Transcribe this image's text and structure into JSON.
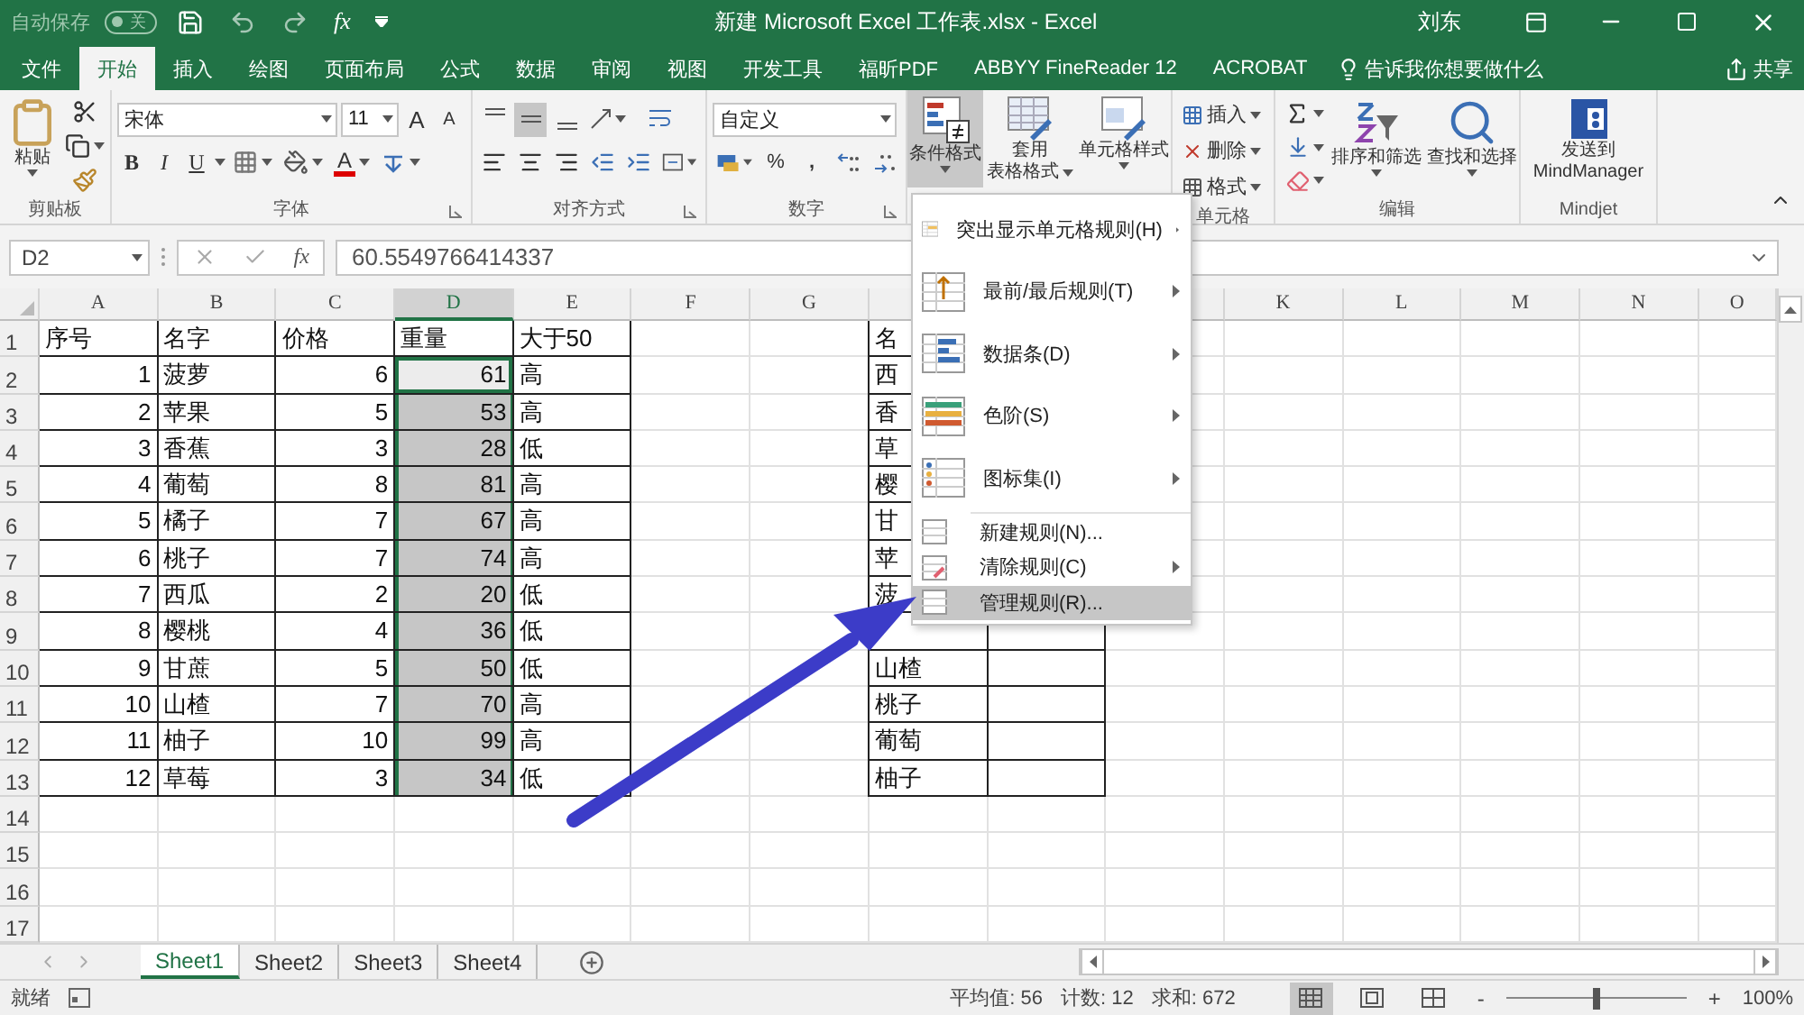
{
  "title_bar": {
    "autosave_label": "自动保存",
    "autosave": {
      "on": false,
      "label": "关"
    },
    "qat_function": "fx",
    "title": "新建 Microsoft Excel 工作表.xlsx  -  Excel",
    "user": "刘东"
  },
  "tabs": [
    {
      "label": "文件",
      "selected": false
    },
    {
      "label": "开始",
      "selected": true
    },
    {
      "label": "插入",
      "selected": false
    },
    {
      "label": "绘图",
      "selected": false
    },
    {
      "label": "页面布局",
      "selected": false
    },
    {
      "label": "公式",
      "selected": false
    },
    {
      "label": "数据",
      "selected": false
    },
    {
      "label": "审阅",
      "selected": false
    },
    {
      "label": "视图",
      "selected": false
    },
    {
      "label": "开发工具",
      "selected": false
    },
    {
      "label": "福昕PDF",
      "selected": false
    },
    {
      "label": "ABBYY FineReader 12",
      "selected": false
    },
    {
      "label": "ACROBAT",
      "selected": false
    }
  ],
  "tell_me": "告诉我你想要做什么",
  "share": "共享",
  "ribbon": {
    "clipboard": {
      "paste": "粘贴",
      "label": "剪贴板"
    },
    "font": {
      "name": "宋体",
      "size": "11",
      "grow": "A",
      "shrink": "A",
      "bold": "B",
      "italic": "I",
      "underline": "U",
      "color_letter": "A",
      "label": "字体"
    },
    "alignment": {
      "vertical": [
        {
          "selected": false
        },
        {
          "selected": true
        },
        {
          "selected": false
        }
      ],
      "label": "对齐方式"
    },
    "number": {
      "format": "自定义",
      "percent": "%",
      "comma": ",",
      "label": "数字"
    },
    "styles": {
      "conditional": {
        "label": "条件格式",
        "pressed": true
      },
      "table_format": [
        "套用",
        "表格格式"
      ],
      "cell_styles": "单元格样式"
    },
    "cells": {
      "insert": "插入",
      "delete": "删除",
      "format": "格式",
      "label": "单元格"
    },
    "editing": {
      "sort": "排序和筛选",
      "find": "查找和选择",
      "label": "编辑"
    },
    "mindjet": {
      "send": [
        "发送到",
        "MindManager"
      ],
      "label": "Mindjet"
    }
  },
  "formula_bar": {
    "name_box": "D2",
    "function_label": "fx",
    "formula": "60.5549766414337"
  },
  "columns": [
    {
      "label": "A",
      "selected": false
    },
    {
      "label": "B",
      "selected": false
    },
    {
      "label": "C",
      "selected": false
    },
    {
      "label": "D",
      "selected": true
    },
    {
      "label": "E",
      "selected": false
    },
    {
      "label": "F",
      "selected": false
    },
    {
      "label": "G",
      "selected": false
    },
    {},
    {},
    {},
    {
      "label": "K",
      "selected": false
    },
    {
      "label": "L",
      "selected": false
    },
    {
      "label": "M",
      "selected": false
    },
    {
      "label": "N",
      "selected": false
    },
    {
      "label": "O",
      "selected": false
    }
  ],
  "rows": [
    {
      "label": "1",
      "cells": [
        {
          "text": "序号",
          "kind": "text",
          "selected": false
        },
        {
          "text": "名字",
          "kind": "text",
          "selected": false
        },
        {
          "text": "价格",
          "kind": "text",
          "selected": false
        },
        {
          "text": "重量",
          "kind": "text",
          "selected": false
        },
        {
          "text": "大于50",
          "kind": "text",
          "selected": false
        }
      ],
      "lookup": {
        "text": "名"
      }
    },
    {
      "label": "2",
      "cells": [
        {
          "text": "1",
          "kind": "number",
          "selected": false
        },
        {
          "text": "菠萝",
          "kind": "text",
          "selected": false
        },
        {
          "text": "6",
          "kind": "number",
          "selected": false
        },
        {
          "text": "61",
          "kind": "number",
          "selected": true,
          "active": true
        },
        {
          "text": "高",
          "kind": "text",
          "selected": false
        }
      ],
      "lookup": {
        "text": "西"
      }
    },
    {
      "label": "3",
      "cells": [
        {
          "text": "2",
          "kind": "number",
          "selected": false
        },
        {
          "text": "苹果",
          "kind": "text",
          "selected": false
        },
        {
          "text": "5",
          "kind": "number",
          "selected": false
        },
        {
          "text": "53",
          "kind": "number",
          "selected": true
        },
        {
          "text": "高",
          "kind": "text",
          "selected": false
        }
      ],
      "lookup": {
        "text": "香"
      }
    },
    {
      "label": "4",
      "cells": [
        {
          "text": "3",
          "kind": "number",
          "selected": false
        },
        {
          "text": "香蕉",
          "kind": "text",
          "selected": false
        },
        {
          "text": "3",
          "kind": "number",
          "selected": false
        },
        {
          "text": "28",
          "kind": "number",
          "selected": true
        },
        {
          "text": "低",
          "kind": "text",
          "selected": false
        }
      ],
      "lookup": {
        "text": "草"
      }
    },
    {
      "label": "5",
      "cells": [
        {
          "text": "4",
          "kind": "number",
          "selected": false
        },
        {
          "text": "葡萄",
          "kind": "text",
          "selected": false
        },
        {
          "text": "8",
          "kind": "number",
          "selected": false
        },
        {
          "text": "81",
          "kind": "number",
          "selected": true
        },
        {
          "text": "高",
          "kind": "text",
          "selected": false
        }
      ],
      "lookup": {
        "text": "樱"
      }
    },
    {
      "label": "6",
      "cells": [
        {
          "text": "5",
          "kind": "number",
          "selected": false
        },
        {
          "text": "橘子",
          "kind": "text",
          "selected": false
        },
        {
          "text": "7",
          "kind": "number",
          "selected": false
        },
        {
          "text": "67",
          "kind": "number",
          "selected": true
        },
        {
          "text": "高",
          "kind": "text",
          "selected": false
        }
      ],
      "lookup": {
        "text": "甘"
      }
    },
    {
      "label": "7",
      "cells": [
        {
          "text": "6",
          "kind": "number",
          "selected": false
        },
        {
          "text": "桃子",
          "kind": "text",
          "selected": false
        },
        {
          "text": "7",
          "kind": "number",
          "selected": false
        },
        {
          "text": "74",
          "kind": "number",
          "selected": true
        },
        {
          "text": "高",
          "kind": "text",
          "selected": false
        }
      ],
      "lookup": {
        "text": "苹"
      }
    },
    {
      "label": "8",
      "cells": [
        {
          "text": "7",
          "kind": "number",
          "selected": false
        },
        {
          "text": "西瓜",
          "kind": "text",
          "selected": false
        },
        {
          "text": "2",
          "kind": "number",
          "selected": false
        },
        {
          "text": "20",
          "kind": "number",
          "selected": true
        },
        {
          "text": "低",
          "kind": "text",
          "selected": false
        }
      ],
      "lookup": {
        "text": "菠"
      }
    },
    {
      "label": "9",
      "cells": [
        {
          "text": "8",
          "kind": "number",
          "selected": false
        },
        {
          "text": "樱桃",
          "kind": "text",
          "selected": false
        },
        {
          "text": "4",
          "kind": "number",
          "selected": false
        },
        {
          "text": "36",
          "kind": "number",
          "selected": true
        },
        {
          "text": "低",
          "kind": "text",
          "selected": false
        }
      ],
      "lookup": {}
    },
    {
      "label": "10",
      "cells": [
        {
          "text": "9",
          "kind": "number",
          "selected": false
        },
        {
          "text": "甘蔗",
          "kind": "text",
          "selected": false
        },
        {
          "text": "5",
          "kind": "number",
          "selected": false
        },
        {
          "text": "50",
          "kind": "number",
          "selected": true
        },
        {
          "text": "低",
          "kind": "text",
          "selected": false
        }
      ],
      "lookup": {
        "text": "山楂"
      }
    },
    {
      "label": "11",
      "cells": [
        {
          "text": "10",
          "kind": "number",
          "selected": false
        },
        {
          "text": "山楂",
          "kind": "text",
          "selected": false
        },
        {
          "text": "7",
          "kind": "number",
          "selected": false
        },
        {
          "text": "70",
          "kind": "number",
          "selected": true
        },
        {
          "text": "高",
          "kind": "text",
          "selected": false
        }
      ],
      "lookup": {
        "text": "桃子"
      }
    },
    {
      "label": "12",
      "cells": [
        {
          "text": "11",
          "kind": "number",
          "selected": false
        },
        {
          "text": "柚子",
          "kind": "text",
          "selected": false
        },
        {
          "text": "10",
          "kind": "number",
          "selected": false
        },
        {
          "text": "99",
          "kind": "number",
          "selected": true
        },
        {
          "text": "高",
          "kind": "text",
          "selected": false
        }
      ],
      "lookup": {
        "text": "葡萄"
      }
    },
    {
      "label": "13",
      "cells": [
        {
          "text": "12",
          "kind": "number",
          "selected": false
        },
        {
          "text": "草莓",
          "kind": "text",
          "selected": false
        },
        {
          "text": "3",
          "kind": "number",
          "selected": false
        },
        {
          "text": "34",
          "kind": "number",
          "selected": true
        },
        {
          "text": "低",
          "kind": "text",
          "selected": false
        }
      ],
      "lookup": {
        "text": "柚子"
      }
    },
    {
      "label": "14"
    },
    {
      "label": "15"
    },
    {
      "label": "16"
    },
    {
      "label": "17"
    }
  ],
  "menu": {
    "items": [
      {
        "kind": "large",
        "label": "突出显示单元格规则(H)",
        "submenu": true,
        "selected": false
      },
      {
        "kind": "large",
        "label": "最前/最后规则(T)",
        "submenu": true,
        "selected": false
      },
      {
        "kind": "large",
        "label": "数据条(D)",
        "submenu": true,
        "selected": false
      },
      {
        "kind": "large",
        "label": "色阶(S)",
        "submenu": true,
        "selected": false
      },
      {
        "kind": "large",
        "label": "图标集(I)",
        "submenu": true,
        "selected": false
      },
      {
        "kind": "small",
        "label": "新建规则(N)...",
        "submenu": false,
        "selected": false
      },
      {
        "kind": "small",
        "label": "清除规则(C)",
        "submenu": true,
        "selected": false
      },
      {
        "kind": "small",
        "label": "管理规则(R)...",
        "submenu": false,
        "selected": true
      }
    ]
  },
  "sheets": [
    {
      "label": "Sheet1",
      "selected": true
    },
    {
      "label": "Sheet2",
      "selected": false
    },
    {
      "label": "Sheet3",
      "selected": false
    },
    {
      "label": "Sheet4",
      "selected": false
    }
  ],
  "status_bar": {
    "ready": "就绪",
    "average": "平均值: 56",
    "count": "计数: 12",
    "sum": "求和: 672",
    "views": [
      {
        "selected": true
      },
      {
        "selected": false
      },
      {
        "selected": false
      }
    ],
    "zoom": {
      "minus": "-",
      "plus": "+",
      "level": 0.5,
      "reading": "100%"
    }
  }
}
